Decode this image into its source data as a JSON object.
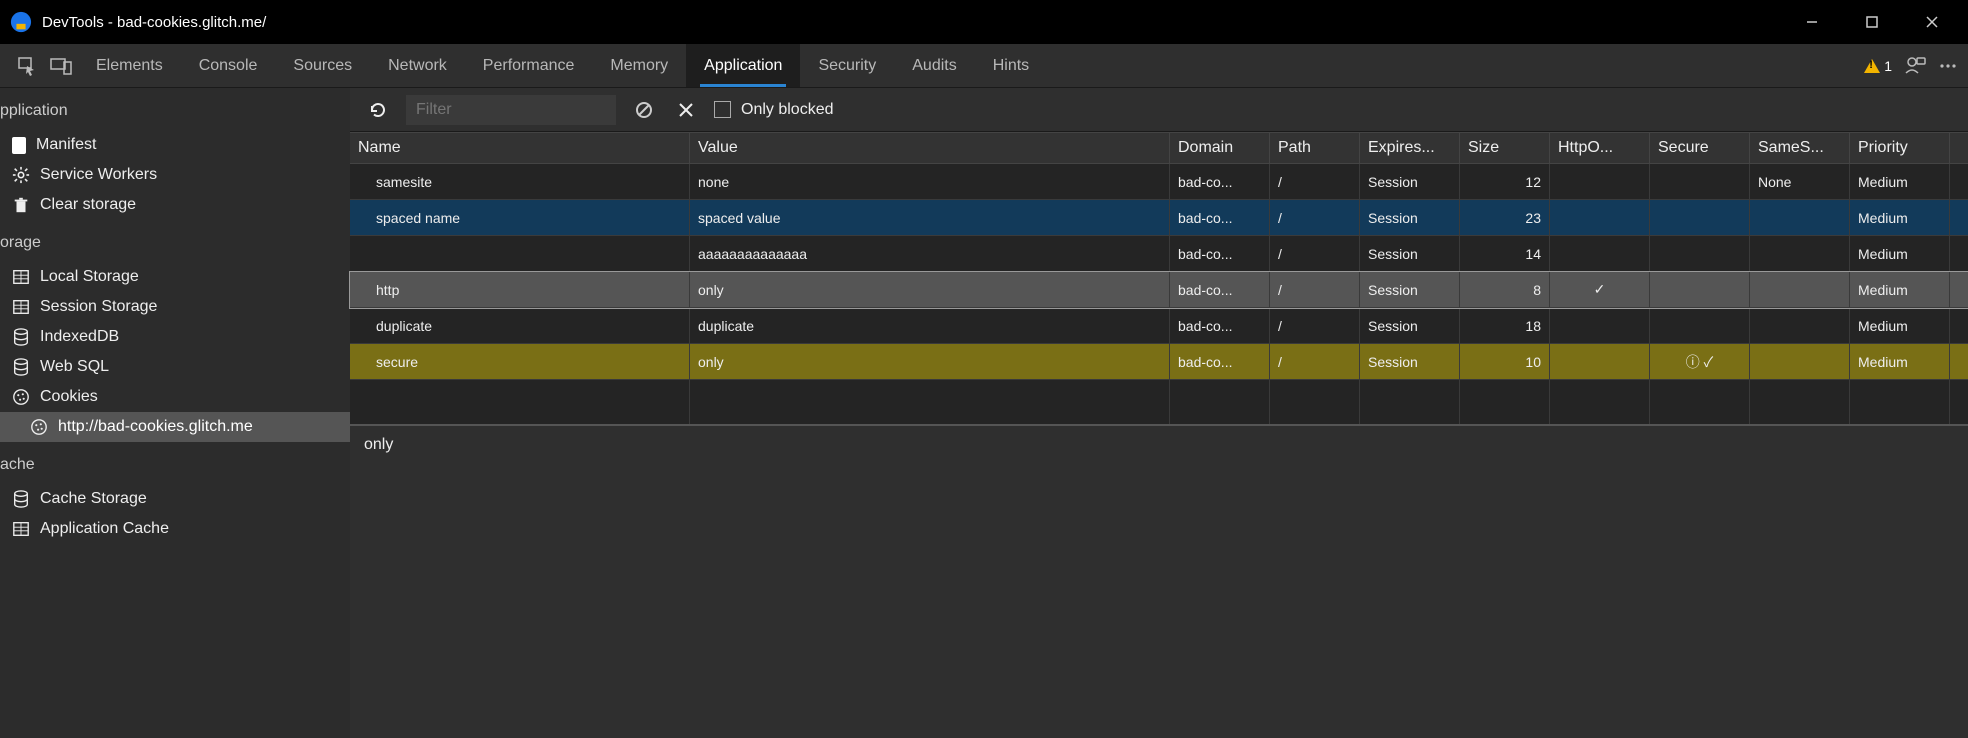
{
  "window": {
    "title": "DevTools - bad-cookies.glitch.me/"
  },
  "tabs": {
    "items": [
      "Elements",
      "Console",
      "Sources",
      "Network",
      "Performance",
      "Memory",
      "Application",
      "Security",
      "Audits",
      "Hints"
    ],
    "active": "Application",
    "warn_count": "1"
  },
  "sidebar": {
    "groups": {
      "application": {
        "title": "pplication",
        "items": [
          "Manifest",
          "Service Workers",
          "Clear storage"
        ]
      },
      "storage": {
        "title": "orage",
        "items": [
          "Local Storage",
          "Session Storage",
          "IndexedDB",
          "Web SQL",
          "Cookies"
        ],
        "cookie_origin": "http://bad-cookies.glitch.me"
      },
      "cache": {
        "title": "ache",
        "items": [
          "Cache Storage",
          "Application Cache"
        ]
      }
    }
  },
  "toolbar": {
    "filter_placeholder": "Filter",
    "only_blocked": "Only blocked"
  },
  "table": {
    "headers": [
      "Name",
      "Value",
      "Domain",
      "Path",
      "Expires...",
      "Size",
      "HttpO...",
      "Secure",
      "SameS...",
      "Priority"
    ],
    "rows": [
      {
        "name": "samesite",
        "value": "none",
        "domain": "bad-co...",
        "path": "/",
        "expires": "Session",
        "size": "12",
        "httponly": "",
        "secure": "",
        "samesite": "None",
        "priority": "Medium",
        "style": ""
      },
      {
        "name": "spaced name",
        "value": "spaced value",
        "domain": "bad-co...",
        "path": "/",
        "expires": "Session",
        "size": "23",
        "httponly": "",
        "secure": "",
        "samesite": "",
        "priority": "Medium",
        "style": "blue"
      },
      {
        "name": "",
        "value": "aaaaaaaaaaaaaa",
        "domain": "bad-co...",
        "path": "/",
        "expires": "Session",
        "size": "14",
        "httponly": "",
        "secure": "",
        "samesite": "",
        "priority": "Medium",
        "style": ""
      },
      {
        "name": "http",
        "value": "only",
        "domain": "bad-co...",
        "path": "/",
        "expires": "Session",
        "size": "8",
        "httponly": "✓",
        "secure": "",
        "samesite": "",
        "priority": "Medium",
        "style": "gray"
      },
      {
        "name": "duplicate",
        "value": "duplicate",
        "domain": "bad-co...",
        "path": "/",
        "expires": "Session",
        "size": "18",
        "httponly": "",
        "secure": "",
        "samesite": "",
        "priority": "Medium",
        "style": ""
      },
      {
        "name": "secure",
        "value": "only",
        "domain": "bad-co...",
        "path": "/",
        "expires": "Session",
        "size": "10",
        "httponly": "",
        "secure": "ⓘ ✓",
        "samesite": "",
        "priority": "Medium",
        "style": "olive"
      }
    ]
  },
  "detail": {
    "value": "only"
  }
}
